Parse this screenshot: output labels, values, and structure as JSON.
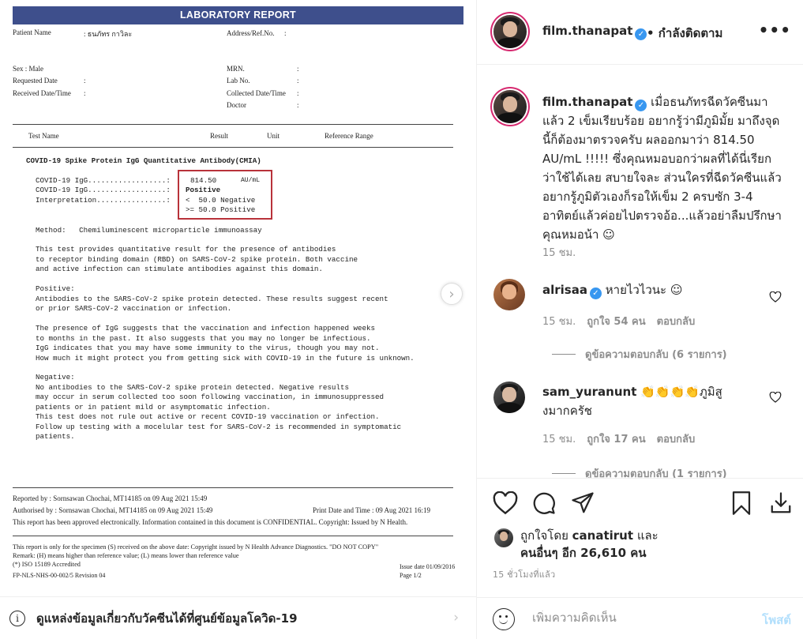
{
  "report": {
    "banner": "LABORATORY REPORT",
    "patient_label": "Patient Name",
    "patient_value": ": ธนภัทร กาวิละ",
    "address_label": "Address/Ref.No.",
    "colon": ":",
    "sex_label": "Sex : Male",
    "requested_label": "Requested Date",
    "received_label": "Received Date/Time",
    "mrn_label": "MRN.",
    "labno_label": "Lab No.",
    "collected_label": "Collected Date/Time",
    "doctor_label": "Doctor",
    "col_test": "Test Name",
    "col_result": "Result",
    "col_unit": "Unit",
    "col_ref": "Reference Range",
    "test_title": "COVID-19 Spike Protein IgG Quantitative Antibody(CMIA)",
    "line1": "COVID-19 IgG..................:",
    "line1_val": "  814.50",
    "line1_unit": "AU/mL",
    "line2": "COVID-19 IgG..................:",
    "line2_val": "Positive",
    "line3": "Interpretation................:",
    "line3_val": "<  50.0 Negative",
    "line4_val": ">= 50.0 Positive",
    "method": "Method:   Chemiluminescent microparticle immunoassay",
    "para1": "This test provides quantitative result for the presence of antibodies\nto receptor binding domain (RBD) on SARS-CoV-2 spike protein. Both vaccine\nand active infection can stimulate antibodies against this domain.",
    "para2": "Positive:\nAntibodies to the SARS-CoV-2 spike protein detected. These results suggest recent\nor prior SARS-CoV-2 vaccination or infection.",
    "para3": "The presence of IgG suggests that the vaccination and infection happened weeks\nto months in the past. It also suggests that you may no longer be infectious.\nIgG indicates that you may have some immunity to the virus, though you may not.\nHow much it might protect you from getting sick with COVID-19 in the future is unknown.",
    "para4": "Negative:\nNo antibodies to the SARS-CoV-2 spike protein detected. Negative results\nmay occur in serum collected too soon following vaccination, in immunosuppressed\npatients or in patient mild or asymptomatic infection.\nThis test does not rule out active or recent COVID-19 vaccination or infection.\nFollow up testing with a mocelular test for SARS-CoV-2 is recommended in symptomatic\npatients.",
    "reported_by": "Reported by : Sornsawan Chochai, MT14185 on 09 Aug 2021 15:49",
    "authorised_by": "Authorised by : Sornsawan Chochai, MT14185 on 09 Aug 2021 15:49",
    "print_time": "Print Date and Time : 09 Aug 2021 16:19",
    "approved": "This report has been approved electronically. Information contained in this document is CONFIDENTIAL. Copyright: Issued by N Health.",
    "footer1": "This report is only for the specimen (S) received on the above date: Copyright issued by N Health Advance Diagnostics. \"DO NOT COPY\"",
    "footer2": "Remark: (H) means higher than reference value; (L) means lower than reference value",
    "footer3": "(*) ISO 15189 Accredited",
    "footer4": "FP-NLS-NHS-00-002/5 Revision 04",
    "issue": "Issue date 01/09/2016",
    "page": "Page 1/2"
  },
  "covid_bar": {
    "text": "ดูแหล่งข้อมูลเกี่ยวกับวัคซีนได้ที่ศูนย์ข้อมูลโควิด-19",
    "info_icon": "i",
    "chevron": "›"
  },
  "header": {
    "username": "film.thanapat",
    "verified_mark": "✓",
    "following": "• กำลังติดตาม",
    "more": "•••"
  },
  "caption": {
    "username": "film.thanapat",
    "text": "เมื่อธนภัทรฉีดวัคซีนมาแล้ว 2 เข็มเรียบร้อย อยากรู้ว่ามีภูมิมั้ย มาถึงจุดนี้ก็ต้องมาตรวจครับ ผลออกมาว่า 814.50 AU/mL !!!!! ซึ่งคุณหมอบอกว่าผลที่ได้นี่เรียกว่าใช้ได้เลย สบายใจละ ส่วนใครที่ฉีดวัคซีนแล้ว อยากรู้ภูมิตัวเองก็รอให้เข็ม 2 ครบซัก 3-4 อาทิตย์แล้วค่อยไปตรวจอ้อ...แล้วอย่าลืมปรึกษาคุณหมอน้า ☺",
    "time": "15 ชม."
  },
  "comments": [
    {
      "username": "alrisaa",
      "verified": true,
      "text": "หายไวไวนะ ☺",
      "time": "15 ชม.",
      "likes": "ถูกใจ 54 คน",
      "reply": "ตอบกลับ",
      "view_replies": "ดูข้อความตอบกลับ (6 รายการ)"
    },
    {
      "username": "sam_yuranunt",
      "verified": false,
      "text": "👏👏👏👏ภูมิสูงมากครัช",
      "time": "15 ชม.",
      "likes": "ถูกใจ 17 คน",
      "reply": "ตอบกลับ",
      "view_replies": "ดูข้อความตอบกลับ (1 รายการ)"
    }
  ],
  "likes": {
    "prefix": "ถูกใจโดย",
    "user": "canatirut",
    "and": "และ",
    "others": "คนอื่นๆ อีก 26,610 คน"
  },
  "timestamp": "15 ชั่วโมงที่แล้ว",
  "comment_input": {
    "placeholder": "เพิ่มความคิดเห็น",
    "post": "โพสต์"
  }
}
